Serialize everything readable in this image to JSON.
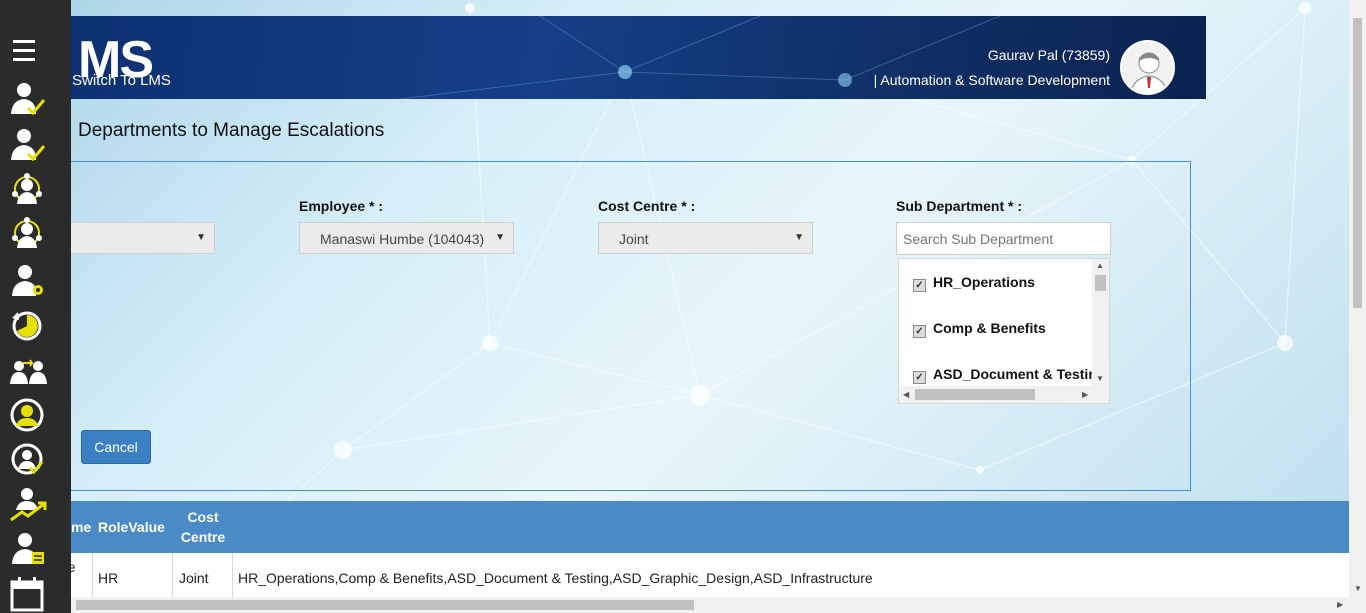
{
  "header": {
    "logo_text": "MS",
    "switch_label": "Switch To LMS",
    "user_name": "Gaurav Pal (73859)",
    "user_dept": "| Automation & Software Development"
  },
  "sidebar": {
    "items": [
      {
        "icon": "menu-icon"
      },
      {
        "icon": "user-check-icon"
      },
      {
        "icon": "user-check-icon"
      },
      {
        "icon": "user-network-icon"
      },
      {
        "icon": "user-network-icon"
      },
      {
        "icon": "user-settings-icon"
      },
      {
        "icon": "clock-refresh-icon"
      },
      {
        "icon": "user-transfer-icon"
      },
      {
        "icon": "user-circle-icon"
      },
      {
        "icon": "user-refresh-icon"
      },
      {
        "icon": "user-growth-icon"
      },
      {
        "icon": "user-document-icon"
      },
      {
        "icon": "calendar-icon"
      }
    ]
  },
  "page": {
    "title": "Departments to Manage Escalations"
  },
  "form": {
    "employee_label": "Employee * :",
    "employee_value": "Manaswi Humbe (104043)",
    "cost_centre_label": "Cost Centre * :",
    "cost_centre_value": "Joint",
    "sub_department_label": "Sub Department * :",
    "search_placeholder": "Search Sub Department",
    "sub_departments": [
      {
        "label": "HR_Operations",
        "checked": true
      },
      {
        "label": "Comp & Benefits",
        "checked": true
      },
      {
        "label": "ASD_Document & Testing",
        "checked": true
      }
    ],
    "cancel_label": "Cancel"
  },
  "table": {
    "headers": {
      "name_partial": "me",
      "role": "RoleValue",
      "cost_centre_line1": "Cost",
      "cost_centre_line2": "Centre"
    },
    "rows": [
      {
        "name_partial": "be",
        "role": "HR",
        "cost_centre": "Joint",
        "departments": "HR_Operations,Comp & Benefits,ASD_Document & Testing,ASD_Graphic_Design,ASD_Infrastructure"
      }
    ]
  },
  "colors": {
    "sidebar_bg": "#2b2b2b",
    "icon_accent": "#e8e000",
    "banner": "#0b2f6e",
    "table_header": "#4a8ac6",
    "button": "#3b7fc4"
  }
}
